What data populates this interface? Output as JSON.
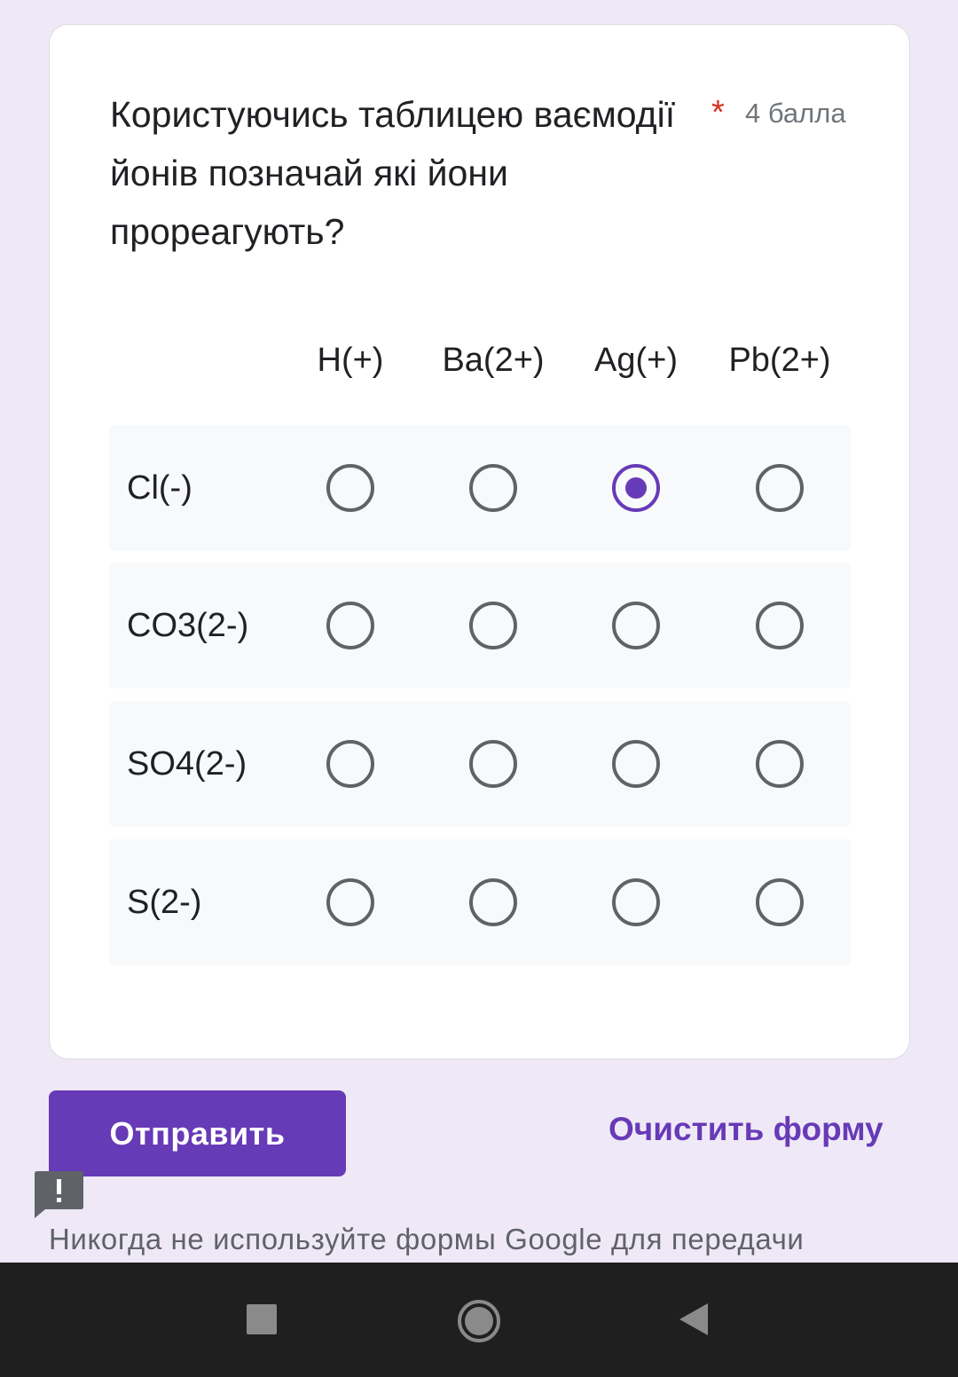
{
  "question": {
    "text": "Користуючись таблицею ваємодії  йонів позначай які йони прореагують?",
    "required_mark": "*",
    "points": "4 балла"
  },
  "grid": {
    "columns": [
      "H(+)",
      "Ba(2+)",
      "Ag(+)",
      "Pb(2+)"
    ],
    "rows": [
      {
        "label": "Cl(-)",
        "selected_column": "Ag(+)"
      },
      {
        "label": "CO3(2-)",
        "selected_column": null
      },
      {
        "label": "SO4(2-)",
        "selected_column": null
      },
      {
        "label": "S(2-)",
        "selected_column": null
      }
    ]
  },
  "actions": {
    "submit_label": "Отправить",
    "clear_label": "Очистить форму"
  },
  "footer": {
    "report_icon": "feedback-icon",
    "disclaimer": "Никогда не используйте формы Google для передачи"
  },
  "system_nav": {
    "icons": [
      "recents-square-icon",
      "home-circle-icon",
      "back-triangle-icon"
    ]
  },
  "colors": {
    "accent": "#673ab7",
    "background": "#efe9f7",
    "required": "#d93025",
    "radio_unselected": "#5f6368",
    "nav_bar": "#1f1f1f"
  }
}
